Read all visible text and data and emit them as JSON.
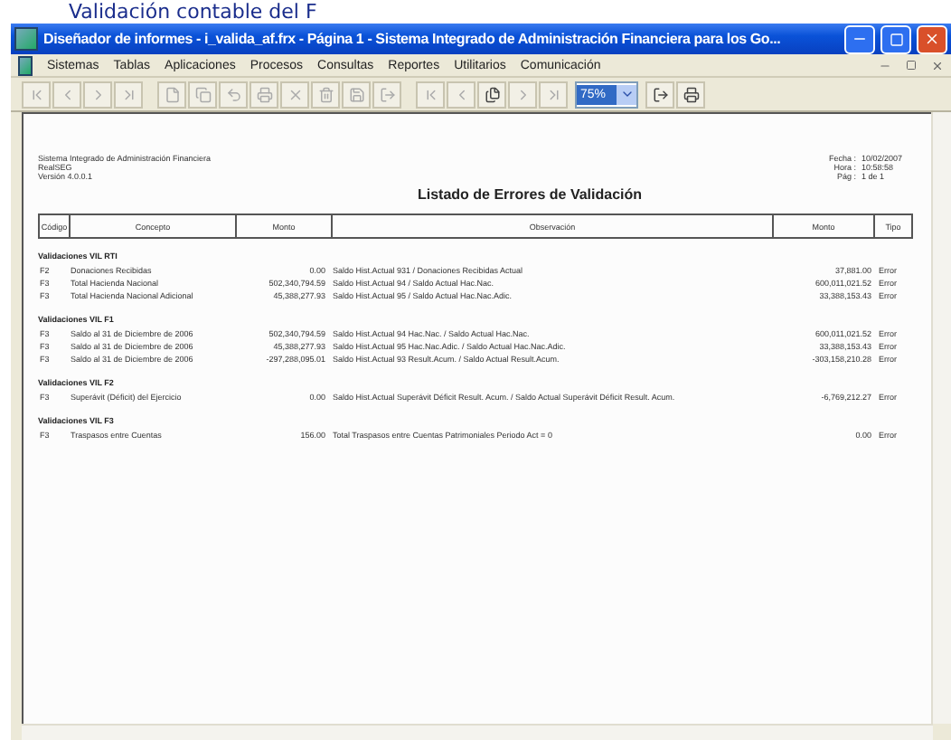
{
  "caption": "Validación contable del F",
  "window": {
    "title": "Diseñador de informes - i_valida_af.frx - Página 1 - Sistema Integrado de Administración Financiera para los Go..."
  },
  "menu": [
    "Sistemas",
    "Tablas",
    "Aplicaciones",
    "Procesos",
    "Consultas",
    "Reportes",
    "Utilitarios",
    "Comunicación"
  ],
  "toolbar": {
    "zoom": "75%"
  },
  "report": {
    "header_left": [
      "Sistema Integrado de Administración Financiera",
      "RealSEG",
      "Versión 4.0.0.1"
    ],
    "header_right": [
      {
        "label": "Fecha :",
        "value": "10/02/2007"
      },
      {
        "label": "Hora :",
        "value": "10:58:58"
      },
      {
        "label": "Pág :",
        "value": "1 de 1"
      }
    ],
    "title": "Listado de Errores de Validación",
    "columns": [
      "Código",
      "Concepto",
      "Monto",
      "Observación",
      "Monto",
      "Tipo"
    ],
    "groups": [
      {
        "name": "Validaciones VIL RTI",
        "rows": [
          [
            "F2",
            "Donaciones Recibidas",
            "0.00",
            "Saldo Hist.Actual 931 / Donaciones Recibidas Actual",
            "37,881.00",
            "Error"
          ],
          [
            "F3",
            "Total Hacienda Nacional",
            "502,340,794.59",
            "Saldo Hist.Actual 94 / Saldo Actual Hac.Nac.",
            "600,011,021.52",
            "Error"
          ],
          [
            "F3",
            "Total Hacienda Nacional Adicional",
            "45,388,277.93",
            "Saldo Hist.Actual 95 / Saldo Actual Hac.Nac.Adic.",
            "33,388,153.43",
            "Error"
          ]
        ]
      },
      {
        "name": "Validaciones VIL F1",
        "rows": [
          [
            "F3",
            "Saldo al 31 de Diciembre de 2006",
            "502,340,794.59",
            "Saldo Hist.Actual 94 Hac.Nac. / Saldo Actual Hac.Nac.",
            "600,011,021.52",
            "Error"
          ],
          [
            "F3",
            "Saldo al 31 de Diciembre de 2006",
            "45,388,277.93",
            "Saldo Hist.Actual 95 Hac.Nac.Adic. / Saldo Actual Hac.Nac.Adic.",
            "33,388,153.43",
            "Error"
          ],
          [
            "F3",
            "Saldo al 31 de Diciembre de 2006",
            "-297,288,095.01",
            "Saldo Hist.Actual 93 Result.Acum. / Saldo Actual Result.Acum.",
            "-303,158,210.28",
            "Error"
          ]
        ]
      },
      {
        "name": "Validaciones VIL F2",
        "rows": [
          [
            "F3",
            "Superávit (Déficit) del Ejercicio",
            "0.00",
            "Saldo Hist.Actual Superávit Déficit Result. Acum. / Saldo Actual Superávit Déficit Result. Acum.",
            "-6,769,212.27",
            "Error"
          ]
        ]
      },
      {
        "name": "Validaciones VIL F3",
        "rows": [
          [
            "F3",
            "Traspasos entre Cuentas",
            "156.00",
            "Total Traspasos entre Cuentas Patrimoniales Periodo Act = 0",
            "0.00",
            "Error"
          ]
        ]
      }
    ]
  }
}
